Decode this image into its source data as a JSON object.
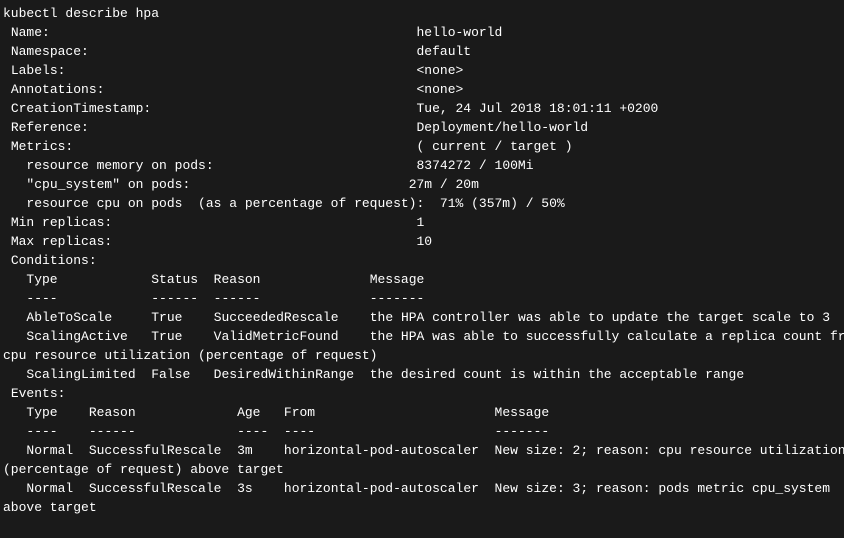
{
  "command": "kubectl describe hpa",
  "fields": {
    "Name": "hello-world",
    "Namespace": "default",
    "Labels": "<none>",
    "Annotations": "<none>",
    "CreationTimestamp": "Tue, 24 Jul 2018 18:01:11 +0200",
    "Reference": "Deployment/hello-world",
    "MetricsHeader": "( current / target )",
    "memory": "8374272 / 100Mi",
    "cpu_system": "27m / 20m",
    "cpu": "71% (357m) / 50%",
    "MinReplicas": "1",
    "MaxReplicas": "10"
  },
  "labels": {
    "Name": "Name:",
    "Namespace": "Namespace:",
    "Labels": "Labels:",
    "Annotations": "Annotations:",
    "CreationTimestamp": "CreationTimestamp:",
    "Reference": "Reference:",
    "Metrics": "Metrics:",
    "memory": "  resource memory on pods:",
    "cpu_system": "  \"cpu_system\" on pods:",
    "cpu": "  resource cpu on pods  (as a percentage of request):",
    "MinReplicas": "Min replicas:",
    "MaxReplicas": "Max replicas:",
    "Conditions": "Conditions:",
    "Events": "Events:"
  },
  "cond": {
    "h1": "Type",
    "h2": "Status",
    "h3": "Reason",
    "h4": "Message",
    "d1": "----",
    "d2": "------",
    "d3": "------",
    "d4": "-------",
    "r1c1": "AbleToScale",
    "r1c2": "True",
    "r1c3": "SucceededRescale",
    "r1c4": "the HPA controller was able to update the target scale to 3",
    "r2c1": "ScalingActive",
    "r2c2": "True",
    "r2c3": "ValidMetricFound",
    "r2c4a": "the HPA was able to successfully calculate a replica count from",
    "r2c4b": "cpu resource utilization (percentage of request)",
    "r3c1": "ScalingLimited",
    "r3c2": "False",
    "r3c3": "DesiredWithinRange",
    "r3c4": "the desired count is within the acceptable range"
  },
  "ev": {
    "h1": "Type",
    "h2": "Reason",
    "h3": "Age",
    "h4": "From",
    "h5": "Message",
    "d1": "----",
    "d2": "------",
    "d3": "----",
    "d4": "----",
    "d5": "-------",
    "r1c1": "Normal",
    "r1c2": "SuccessfulRescale",
    "r1c3": "3m",
    "r1c4": "horizontal-pod-autoscaler",
    "r1c5a": "New size: 2; reason: cpu resource utilization",
    "r1c5b": "(percentage of request) above target",
    "r2c1": "Normal",
    "r2c2": "SuccessfulRescale",
    "r2c3": "3s",
    "r2c4": "horizontal-pod-autoscaler",
    "r2c5a": "New size: 3; reason: pods metric cpu_system",
    "r2c5b": "above target"
  }
}
